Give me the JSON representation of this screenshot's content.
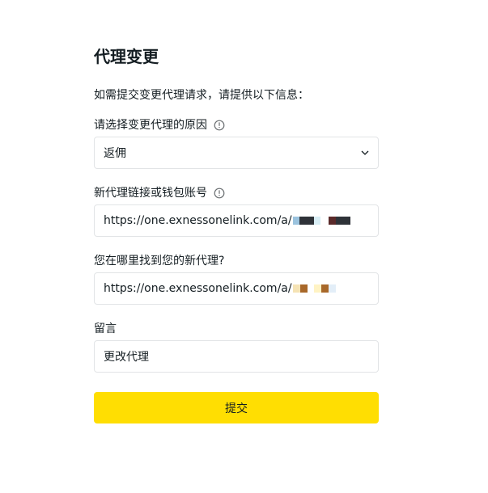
{
  "page": {
    "title": "代理变更",
    "intro": "如需提交变更代理请求，请提供以下信息："
  },
  "reason": {
    "label": "请选择变更代理的原因",
    "value": "返佣",
    "icon": "info-icon"
  },
  "new_agent": {
    "label": "新代理链接或钱包账号",
    "value": "https://one.exnessonelink.com/a/",
    "icon": "info-icon"
  },
  "where_found": {
    "label": "您在哪里找到您的新代理?",
    "value": "https://one.exnessonelink.com/a/"
  },
  "comment": {
    "label": "留言",
    "value": "更改代理"
  },
  "submit_label": "提交",
  "colors": {
    "accent": "#ffde02",
    "text": "#141d22",
    "border": "#e2e4e6"
  }
}
